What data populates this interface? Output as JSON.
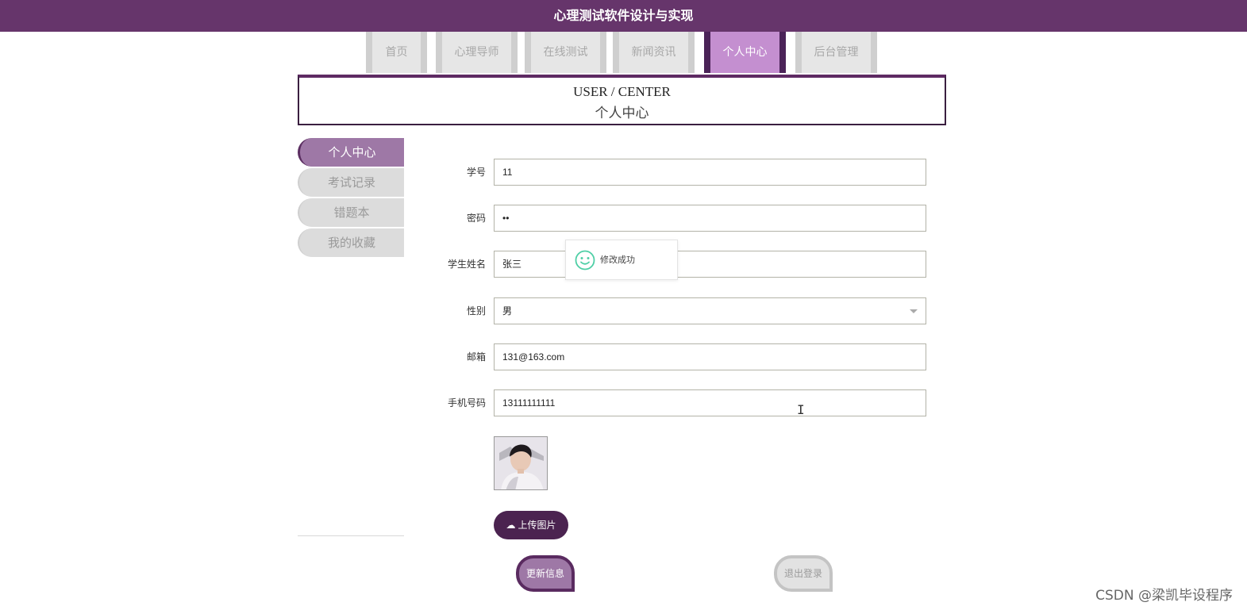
{
  "app": {
    "title": "心理测试软件设计与实现"
  },
  "nav": {
    "items": [
      {
        "label": "首页",
        "active": false
      },
      {
        "label": "心理导师",
        "active": false
      },
      {
        "label": "在线测试",
        "active": false
      },
      {
        "label": "新闻资讯",
        "active": false
      },
      {
        "label": "个人中心",
        "active": true
      },
      {
        "label": "后台管理",
        "active": false
      }
    ]
  },
  "banner": {
    "en": "USER / CENTER",
    "cn": "个人中心"
  },
  "sidebar": {
    "items": [
      {
        "label": "个人中心",
        "active": true
      },
      {
        "label": "考试记录",
        "active": false
      },
      {
        "label": "错题本",
        "active": false
      },
      {
        "label": "我的收藏",
        "active": false
      }
    ]
  },
  "form": {
    "student_id": {
      "label": "学号",
      "value": "11"
    },
    "password": {
      "label": "密码",
      "value": "••"
    },
    "name": {
      "label": "学生姓名",
      "value": "张三"
    },
    "gender": {
      "label": "性别",
      "value": "男"
    },
    "email": {
      "label": "邮箱",
      "value": "131@163.com"
    },
    "phone": {
      "label": "手机号码",
      "value": "13111111111"
    }
  },
  "buttons": {
    "upload": "上传图片",
    "update": "更新信息",
    "logout": "退出登录"
  },
  "toast": {
    "message": "修改成功",
    "icon": "smile-icon"
  },
  "watermark": "CSDN @梁凯毕设程序",
  "colors": {
    "brand": "#66356b",
    "accent": "#c48fd0",
    "side_active": "#9e78a6",
    "toast_icon": "#4fcfa6"
  }
}
